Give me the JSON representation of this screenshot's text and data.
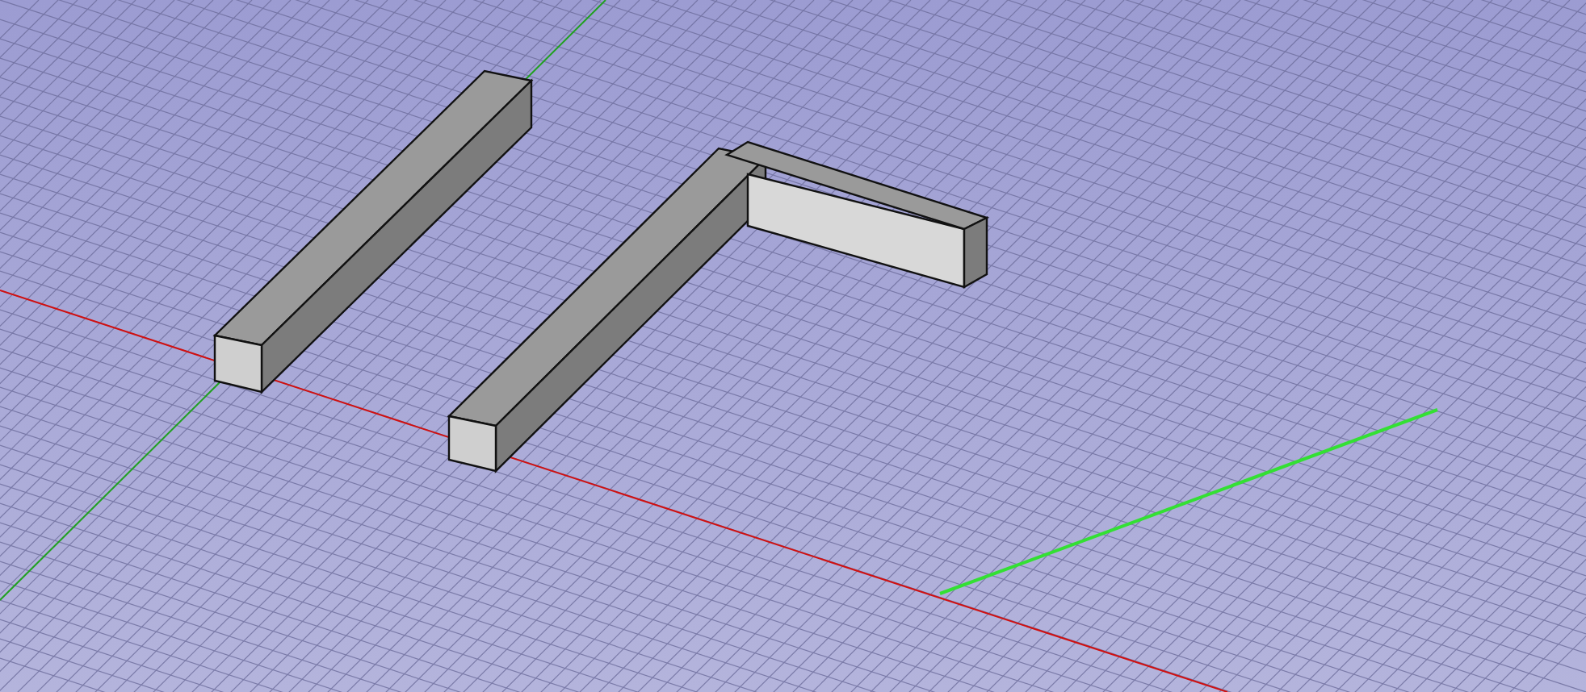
{
  "viewport": {
    "objects": [
      {
        "kind": "beam"
      },
      {
        "kind": "beam"
      },
      {
        "kind": "beam"
      },
      {
        "kind": "line"
      }
    ]
  }
}
